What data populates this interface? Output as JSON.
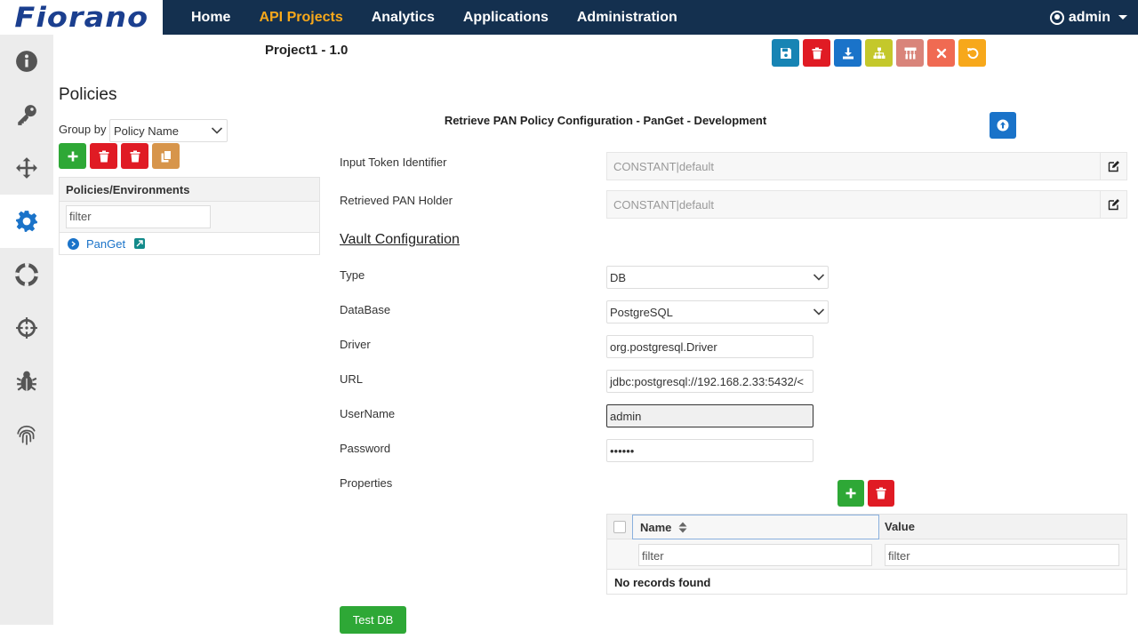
{
  "brand": {
    "logo_text": "Fiorano"
  },
  "nav": {
    "items": [
      {
        "label": "Home",
        "active": false
      },
      {
        "label": "API Projects",
        "active": true
      },
      {
        "label": "Analytics",
        "active": false
      },
      {
        "label": "Applications",
        "active": false
      },
      {
        "label": "Administration",
        "active": false
      }
    ],
    "user": "admin"
  },
  "sidebar": {
    "items": [
      {
        "icon": "info-icon",
        "active": false
      },
      {
        "icon": "key-icon",
        "active": false
      },
      {
        "icon": "move-icon",
        "active": false
      },
      {
        "icon": "gear-icon",
        "active": true
      },
      {
        "icon": "lifebuoy-icon",
        "active": false
      },
      {
        "icon": "crosshair-icon",
        "active": false
      },
      {
        "icon": "bug-icon",
        "active": false
      },
      {
        "icon": "fingerprint-icon",
        "active": false
      }
    ]
  },
  "project": {
    "title": "Project1 - 1.0"
  },
  "toolbar": {
    "buttons": [
      {
        "icon": "save-icon",
        "color": "#1784b4"
      },
      {
        "icon": "trash-icon",
        "color": "#e01b24"
      },
      {
        "icon": "download-icon",
        "color": "#1a73c9"
      },
      {
        "icon": "sitemap-icon",
        "color": "#c4c82b"
      },
      {
        "icon": "hierarchy-icon",
        "color": "#d9847a"
      },
      {
        "icon": "close-icon",
        "color": "#f06a52"
      },
      {
        "icon": "undo-icon",
        "color": "#f7a81b"
      }
    ]
  },
  "policies": {
    "title": "Policies",
    "group_by_label": "Group by",
    "group_by_value": "Policy Name",
    "header": "Policies/Environments",
    "filter_placeholder": "filter",
    "items": [
      {
        "name": "PanGet"
      }
    ]
  },
  "config": {
    "title": "Retrieve PAN Policy Configuration - PanGet - Development",
    "input_token_label": "Input Token Identifier",
    "input_token_value": "CONSTANT|default",
    "retrieved_pan_label": "Retrieved PAN Holder",
    "retrieved_pan_value": "CONSTANT|default",
    "vault_title": "Vault Configuration",
    "type_label": "Type",
    "type_value": "DB",
    "database_label": "DataBase",
    "database_value": "PostgreSQL",
    "driver_label": "Driver",
    "driver_value": "org.postgresql.Driver",
    "url_label": "URL",
    "url_value": "jdbc:postgresql://192.168.2.33:5432/<",
    "username_label": "UserName",
    "username_value": "admin",
    "password_label": "Password",
    "password_value": "••••••",
    "properties_label": "Properties",
    "table": {
      "col_name": "Name",
      "col_value": "Value",
      "filter_placeholder": "filter",
      "empty": "No records found"
    },
    "test_db_label": "Test DB"
  }
}
